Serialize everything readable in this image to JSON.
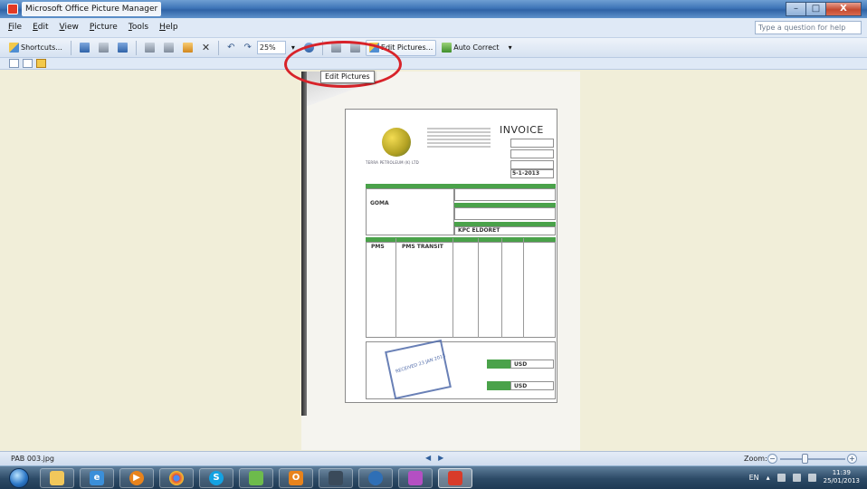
{
  "window": {
    "title": "Microsoft Office Picture Manager"
  },
  "menu": {
    "items": [
      {
        "label": "File",
        "key": "F"
      },
      {
        "label": "Edit",
        "key": "E"
      },
      {
        "label": "View",
        "key": "V"
      },
      {
        "label": "Picture",
        "key": "P"
      },
      {
        "label": "Tools",
        "key": "T"
      },
      {
        "label": "Help",
        "key": "H"
      }
    ],
    "help_placeholder": "Type a question for help"
  },
  "toolbar": {
    "shortcuts_label": "Shortcuts...",
    "zoom_value": "25%",
    "edit_pictures_label": "Edit Pictures...",
    "auto_correct_label": "Auto Correct"
  },
  "tooltip": {
    "text": "Edit Pictures"
  },
  "invoice": {
    "title": "INVOICE",
    "company_caption": "TERRA PETROLEUM (K) LTD",
    "date": "5-1-2013",
    "customer": "GOMA",
    "consignee": "KPC ELDORET",
    "product": "PMS",
    "description": "PMS TRANSIT",
    "currency1": "USD",
    "currency2": "USD"
  },
  "status": {
    "filename": "PAB 003.jpg",
    "zoom_label": "Zoom:",
    "zoom_level": 0.38
  },
  "taskbar": {
    "language": "EN",
    "time": "11:39",
    "date": "25/01/2013"
  },
  "colors": {
    "accent_red": "#d8232a",
    "invoice_green": "#4aa24a",
    "titlebar_blue": "#3e75b7"
  }
}
